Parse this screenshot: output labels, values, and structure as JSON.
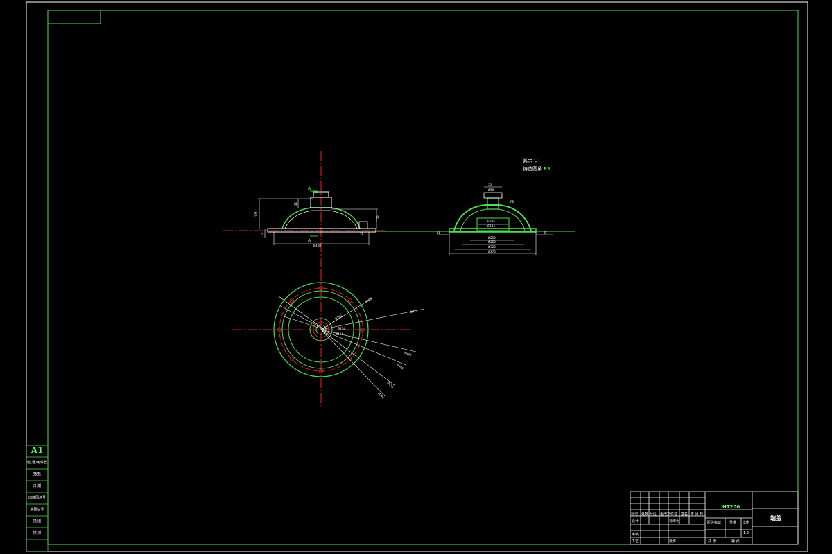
{
  "sheet": {
    "size_label": "A1",
    "left_strip": [
      "借(通)用件登记",
      "旧底图总号",
      "底图总号",
      "签 名",
      "日 期",
      "描 图",
      "校 对"
    ]
  },
  "notes": {
    "surface": "其余",
    "casting": "铸造圆角",
    "casting_value": "R3"
  },
  "section_labels": [
    "A",
    "A"
  ],
  "dims": {
    "front": [
      "174",
      "32",
      "18",
      "138",
      "Ø460",
      "16"
    ],
    "section": [
      "35",
      "Ø50",
      "R5",
      "Ø234",
      "Ø184",
      "Ø250",
      "Ø260",
      "Ø320",
      "Ø375",
      "16",
      "5"
    ],
    "plan": [
      "8xØ8",
      "Ø180",
      "Ø375",
      "Ø460",
      "Ø480",
      "Ø420",
      "Ø384",
      "Ø234",
      "Ø184"
    ]
  },
  "title_block": {
    "material": "HT200",
    "part_name": "端盖",
    "headers": [
      "标记",
      "处数",
      "分区",
      "更改文件号",
      "签名",
      "年 月 日"
    ],
    "rows": [
      "设计",
      "审核",
      "工艺",
      "标准化",
      "批准"
    ],
    "stage_headers": [
      "阶段标记",
      "重量",
      "比例"
    ],
    "scale": "1:2",
    "sheets": [
      "共 张",
      "第 张"
    ]
  }
}
